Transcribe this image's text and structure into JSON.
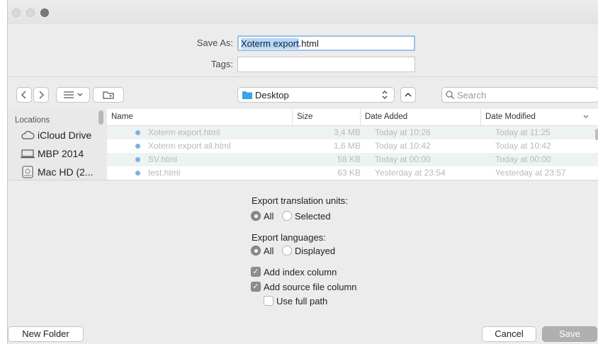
{
  "save_as": {
    "label": "Save As:",
    "value_selected": "Xoterm export",
    "value_rest": ".html"
  },
  "tags": {
    "label": "Tags:",
    "value": ""
  },
  "toolbar": {
    "location": "Desktop",
    "search_placeholder": "Search"
  },
  "sidebar": {
    "header": "Locations",
    "items": [
      {
        "label": "iCloud Drive",
        "icon": "cloud-icon"
      },
      {
        "label": "MBP 2014",
        "icon": "laptop-icon"
      },
      {
        "label": "Mac HD (2...",
        "icon": "disk-icon"
      }
    ]
  },
  "columns": {
    "name": "Name",
    "size": "Size",
    "date_added": "Date Added",
    "date_modified": "Date Modified"
  },
  "files": [
    {
      "name": "Xoterm export.html",
      "size": "3,4 MB",
      "added": "Today at 10:26",
      "modified": "Today at 11:25"
    },
    {
      "name": "Xoterm export all.html",
      "size": "1,6 MB",
      "added": "Today at 10:42",
      "modified": "Today at 10:42"
    },
    {
      "name": "SV.html",
      "size": "58 KB",
      "added": "Today at 00:00",
      "modified": "Today at 00:00"
    },
    {
      "name": "test.html",
      "size": "63 KB",
      "added": "Yesterday at 23:54",
      "modified": "Yesterday at 23:57"
    }
  ],
  "options": {
    "units_label": "Export translation units:",
    "units_all": "All",
    "units_selected": "Selected",
    "langs_label": "Export languages:",
    "langs_all": "All",
    "langs_displayed": "Displayed",
    "add_index": "Add index column",
    "add_source": "Add source file column",
    "use_full_path": "Use full path"
  },
  "buttons": {
    "new_folder": "New Folder",
    "cancel": "Cancel",
    "save": "Save"
  },
  "colors": {
    "selection": "#b3d7ff",
    "disabled_text": "#b9b9b9",
    "folder": "#3ba3e8"
  }
}
